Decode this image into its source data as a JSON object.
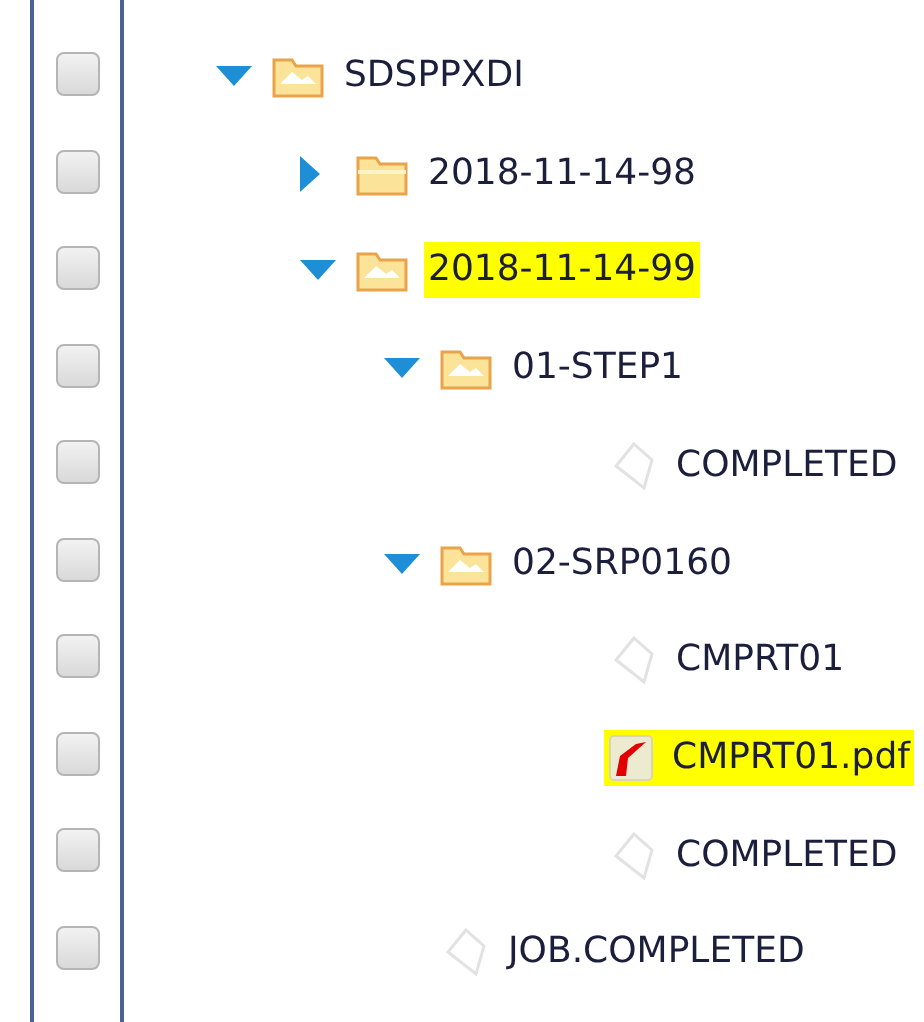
{
  "tree": [
    {
      "label": "SDSPPXDI",
      "kind": "folder",
      "expanded": true,
      "highlighted": false,
      "checked": false,
      "children": [
        {
          "label": "2018-11-14-98",
          "kind": "folder",
          "expanded": false,
          "highlighted": false,
          "checked": false
        },
        {
          "label": "2018-11-14-99",
          "kind": "folder",
          "expanded": true,
          "highlighted": true,
          "checked": false,
          "children": [
            {
              "label": "01-STEP1",
              "kind": "folder",
              "expanded": true,
              "highlighted": false,
              "checked": false,
              "children": [
                {
                  "label": "COMPLETED",
                  "kind": "file",
                  "highlighted": false,
                  "checked": false
                }
              ]
            },
            {
              "label": "02-SRP0160",
              "kind": "folder",
              "expanded": true,
              "highlighted": false,
              "checked": false,
              "children": [
                {
                  "label": "CMPRT01",
                  "kind": "file",
                  "highlighted": false,
                  "checked": false
                },
                {
                  "label": "CMPRT01.pdf",
                  "kind": "pdf",
                  "highlighted": true,
                  "checked": false
                },
                {
                  "label": "COMPLETED",
                  "kind": "file",
                  "highlighted": false,
                  "checked": false
                }
              ]
            }
          ]
        },
        {
          "label": "JOB.COMPLETED",
          "kind": "file",
          "highlighted": false,
          "checked": false
        }
      ]
    }
  ]
}
